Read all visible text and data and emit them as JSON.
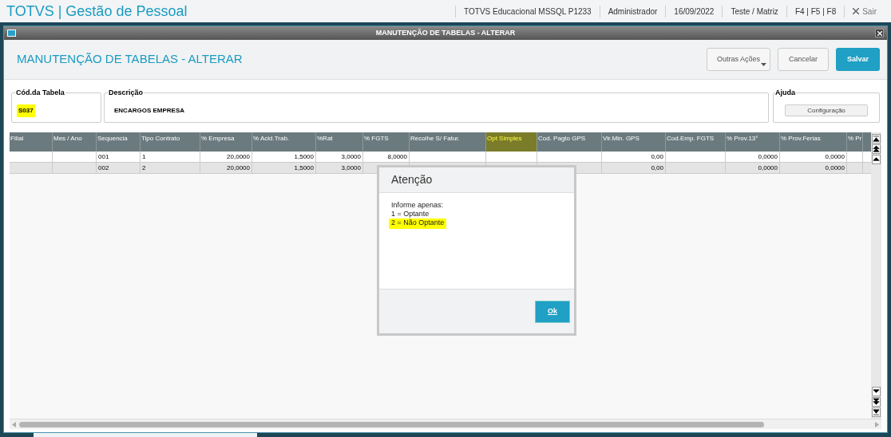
{
  "app_bar": {
    "title": "TOTVS | Gestão de Pessoal",
    "items": [
      "TOTVS Educacional MSSQL P1233",
      "Administrador",
      "16/09/2022",
      "Teste / Matriz",
      "F4 | F5 | F8"
    ],
    "exit": "Sair"
  },
  "window": {
    "title": "MANUTENÇÃO DE TABELAS - ALTERAR"
  },
  "header": {
    "title": "MANUTENÇÃO DE TABELAS - ALTERAR",
    "buttons": [
      {
        "label": "Outras Ações",
        "kind": "menu"
      },
      {
        "label": "Cancelar",
        "kind": "default"
      },
      {
        "label": "Salvar",
        "kind": "primary"
      }
    ]
  },
  "fields": [
    {
      "legend": "Cód.da Tabela",
      "value": "S037",
      "highlighted": true
    },
    {
      "legend": "Descrição",
      "value": "ENCARGOS EMPRESA",
      "highlighted": false
    }
  ],
  "help": {
    "legend": "Ajuda",
    "button": "Configuração"
  },
  "table": {
    "columns": [
      {
        "label": "Filial",
        "highlighted": false
      },
      {
        "label": "Mes / Ano",
        "highlighted": false
      },
      {
        "label": "Sequencia",
        "highlighted": false
      },
      {
        "label": "Tipo Contrato",
        "highlighted": false
      },
      {
        "label": "% Empresa",
        "highlighted": false
      },
      {
        "label": "% Acid.Trab.",
        "highlighted": false
      },
      {
        "label": "%Rat",
        "highlighted": false
      },
      {
        "label": "% FGTS",
        "highlighted": false
      },
      {
        "label": "Recolhe S/ Fatur.",
        "highlighted": false
      },
      {
        "label": "Opt Simples",
        "highlighted": true
      },
      {
        "label": "Cod. Pagto GPS",
        "highlighted": false
      },
      {
        "label": "Vlr.Min. GPS",
        "highlighted": false
      },
      {
        "label": "Cod.Emp. FGTS",
        "highlighted": false
      },
      {
        "label": "% Prov.13°",
        "highlighted": false
      },
      {
        "label": "% Prov.Ferias",
        "highlighted": false
      },
      {
        "label": "% Pr",
        "highlighted": false
      }
    ],
    "rows": [
      {
        "selected": false,
        "cells": [
          null,
          null,
          "001",
          "1",
          "20,0000",
          "1,5000",
          "3,0000",
          "8,0000",
          null,
          null,
          null,
          "0,00",
          null,
          "0,0000",
          "0,0000",
          null
        ]
      },
      {
        "selected": true,
        "cells": [
          null,
          null,
          "002",
          "2",
          "20,0000",
          "1,5000",
          "3,0000",
          null,
          null,
          null,
          null,
          "0,00",
          null,
          "0,0000",
          "0,0000",
          null
        ]
      }
    ]
  },
  "dialog": {
    "title": "Atenção",
    "lines": [
      {
        "text": "Informe apenas:",
        "highlighted": false
      },
      {
        "text": "1 = Optante",
        "highlighted": false
      },
      {
        "text": "2 = Não Optante",
        "highlighted": true
      }
    ],
    "button": "Ok"
  }
}
